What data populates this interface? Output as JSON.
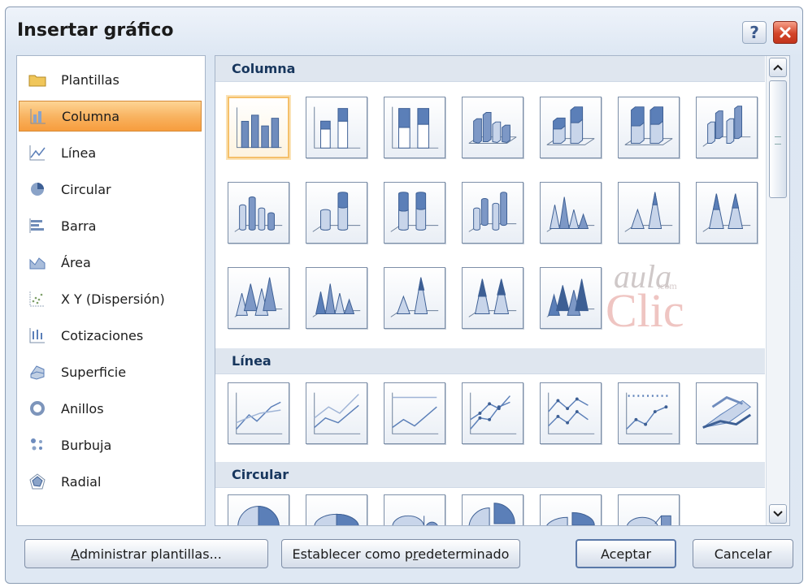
{
  "dialog": {
    "title": "Insertar gráfico",
    "help_label": "?"
  },
  "categories": [
    {
      "label": "Plantillas",
      "icon": "folder-icon"
    },
    {
      "label": "Columna",
      "icon": "column-chart-icon",
      "selected": true
    },
    {
      "label": "Línea",
      "icon": "line-chart-icon"
    },
    {
      "label": "Circular",
      "icon": "pie-chart-icon"
    },
    {
      "label": "Barra",
      "icon": "bar-chart-icon"
    },
    {
      "label": "Área",
      "icon": "area-chart-icon"
    },
    {
      "label": "X Y (Dispersión)",
      "icon": "scatter-chart-icon"
    },
    {
      "label": "Cotizaciones",
      "icon": "stock-chart-icon"
    },
    {
      "label": "Superficie",
      "icon": "surface-chart-icon"
    },
    {
      "label": "Anillos",
      "icon": "doughnut-chart-icon"
    },
    {
      "label": "Burbuja",
      "icon": "bubble-chart-icon"
    },
    {
      "label": "Radial",
      "icon": "radar-chart-icon"
    }
  ],
  "sections": {
    "columna": {
      "label": "Columna",
      "thumb_count": 19
    },
    "linea": {
      "label": "Línea",
      "thumb_count": 7
    },
    "circular": {
      "label": "Circular",
      "thumb_count": 6
    }
  },
  "watermark": {
    "line1": "aula",
    "line2": ".com",
    "line3": "Clic"
  },
  "buttons": {
    "manage_prefix": "",
    "manage_access": "A",
    "manage_rest": "dministrar plantillas...",
    "default_prefix": "Establecer como p",
    "default_access": "r",
    "default_rest": "edeterminado",
    "ok": "Aceptar",
    "cancel": "Cancelar"
  },
  "colors": {
    "accent_selected": "#f8b15d",
    "chart_blue": "#5b7fb8",
    "section_header_bg": "#dfe6ef"
  }
}
